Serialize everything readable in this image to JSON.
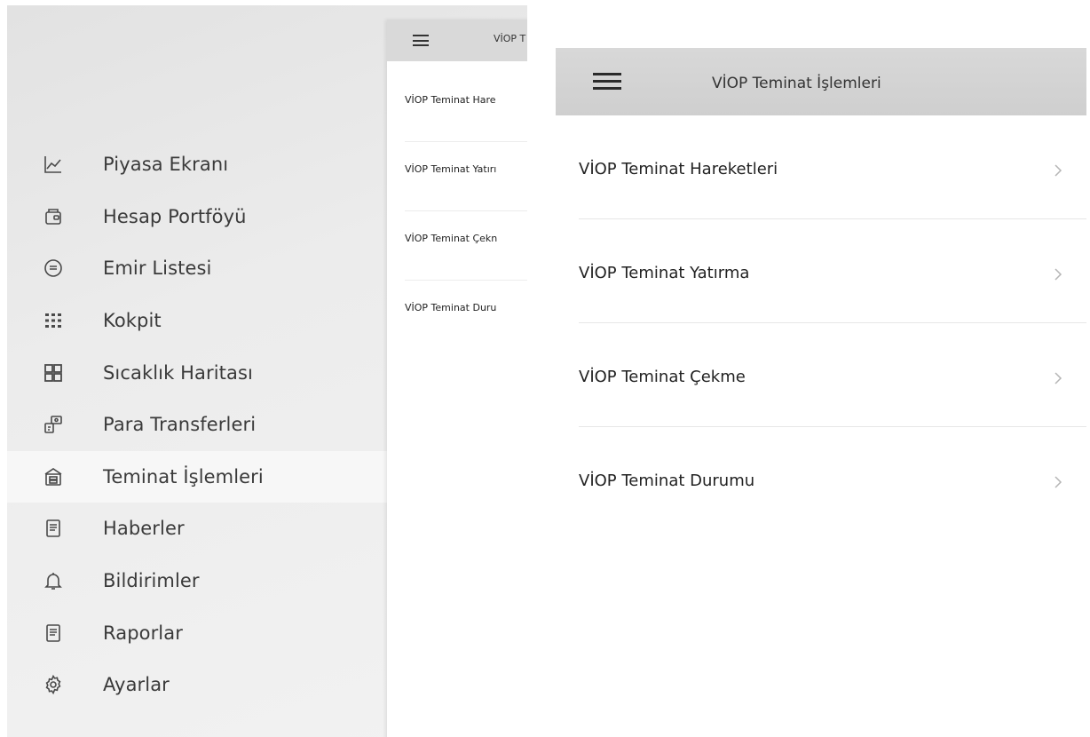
{
  "side_menu": {
    "items": [
      {
        "label": "Piyasa Ekranı",
        "icon": "chart-line-icon"
      },
      {
        "label": "Hesap Portföyü",
        "icon": "wallet-icon"
      },
      {
        "label": "Emir Listesi",
        "icon": "list-circle-icon"
      },
      {
        "label": "Kokpit",
        "icon": "grid-dots-icon"
      },
      {
        "label": "Sıcaklık Haritası",
        "icon": "heatmap-grid-icon"
      },
      {
        "label": "Para Transferleri",
        "icon": "money-transfer-icon"
      },
      {
        "label": "Teminat İşlemleri",
        "icon": "collateral-icon",
        "active": true
      },
      {
        "label": "Haberler",
        "icon": "news-icon"
      },
      {
        "label": "Bildirimler",
        "icon": "bell-icon"
      },
      {
        "label": "Raporlar",
        "icon": "report-icon"
      },
      {
        "label": "Ayarlar",
        "icon": "gear-icon"
      }
    ]
  },
  "background_screen": {
    "title": "VİOP T",
    "items": [
      "VİOP Teminat Hare",
      "VİOP Teminat Yatırı",
      "VİOP Teminat Çekn",
      "VİOP Teminat Duru"
    ]
  },
  "viop_screen": {
    "title": "VİOP Teminat İşlemleri",
    "items": [
      "VİOP Teminat Hareketleri",
      "VİOP Teminat Yatırma",
      "VİOP Teminat Çekme",
      "VİOP Teminat Durumu"
    ]
  },
  "colors": {
    "header_bg": "#d6d6d6",
    "menu_bg": "#ebebeb",
    "active_item_bg": "#f7f7f7",
    "text_primary": "#222222",
    "chevron": "#b5b5b5"
  }
}
